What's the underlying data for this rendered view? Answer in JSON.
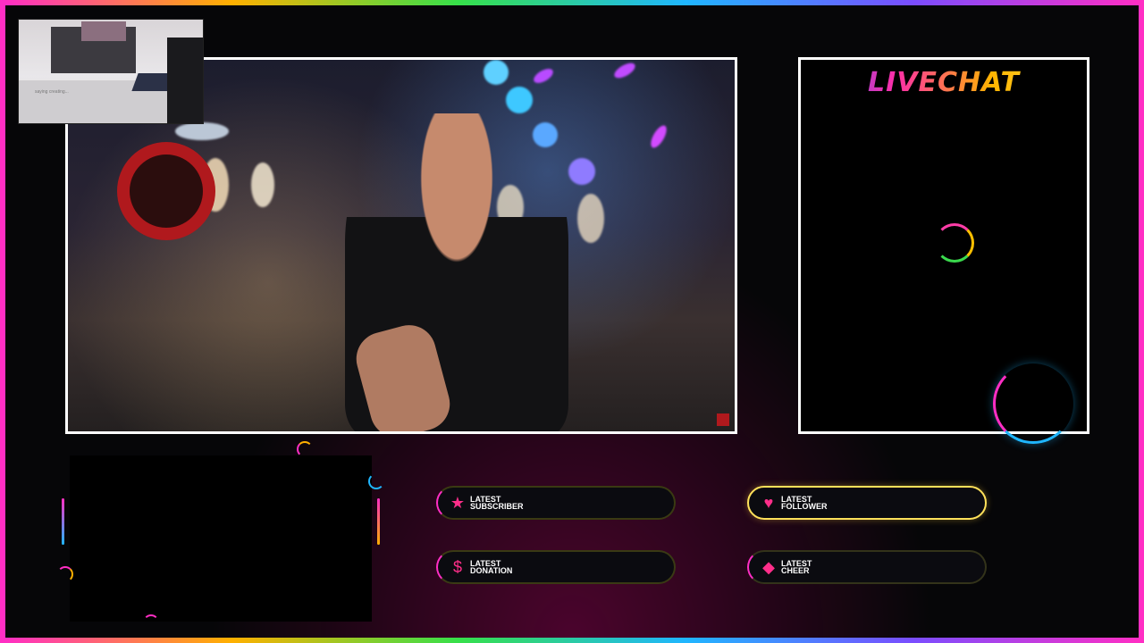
{
  "livechat": {
    "title": "LIVECHAT"
  },
  "webcam": {
    "caption": "saying creating..."
  },
  "widgets": {
    "subscriber": {
      "icon": "star-icon",
      "line1": "LATEST",
      "line2": "SUBSCRIBER"
    },
    "follower": {
      "icon": "heart-icon",
      "line1": "LATEST",
      "line2": "FOLLOWER"
    },
    "donation": {
      "icon": "dollar-icon",
      "line1": "LATEST",
      "line2": "DONATION"
    },
    "cheer": {
      "icon": "diamond-icon",
      "line1": "LATEST",
      "line2": "CHEER"
    }
  },
  "colors": {
    "accent_pink": "#ff2ec4",
    "accent_yellow": "#ffe15a",
    "accent_blue": "#1fb6ff",
    "accent_green": "#36e04a",
    "border_white": "#ffffff",
    "background": "#060608"
  }
}
